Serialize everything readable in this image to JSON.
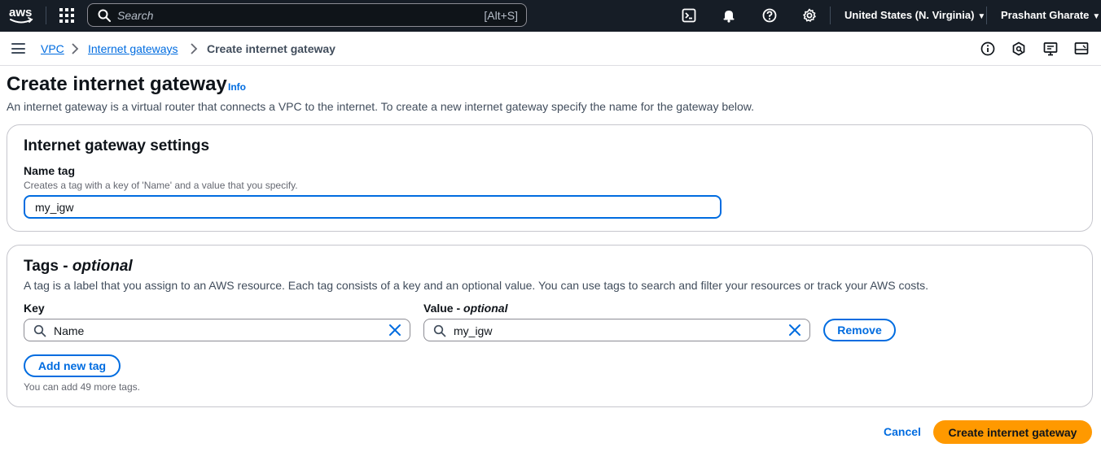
{
  "topnav": {
    "logo_text": "aws",
    "search_placeholder": "Search",
    "search_shortcut": "[Alt+S]",
    "region": "United States (N. Virginia)",
    "user": "Prashant Gharate",
    "bg_color": "#161d26"
  },
  "breadcrumb": {
    "items": [
      "VPC",
      "Internet gateways",
      "Create internet gateway"
    ]
  },
  "page": {
    "title": "Create internet gateway",
    "info": "Info",
    "description": "An internet gateway is a virtual router that connects a VPC to the internet. To create a new internet gateway specify the name for the gateway below."
  },
  "settings": {
    "title": "Internet gateway settings",
    "name_label": "Name tag",
    "name_hint": "Creates a tag with a key of 'Name' and a value that you specify.",
    "name_value": "my_igw"
  },
  "tags": {
    "title_main": "Tags - ",
    "title_optional": "optional",
    "description": "A tag is a label that you assign to an AWS resource. Each tag consists of a key and an optional value. You can use tags to search and filter your resources or track your AWS costs.",
    "key_label": "Key",
    "value_label_main": "Value - ",
    "value_label_optional": "optional",
    "rows": [
      {
        "key": "Name",
        "value": "my_igw"
      }
    ],
    "remove_label": "Remove",
    "add_label": "Add new tag",
    "limit_hint": "You can add 49 more tags."
  },
  "footer": {
    "cancel_label": "Cancel",
    "create_label": "Create internet gateway",
    "primary_color": "#ff9900",
    "link_color": "#006ce0"
  }
}
